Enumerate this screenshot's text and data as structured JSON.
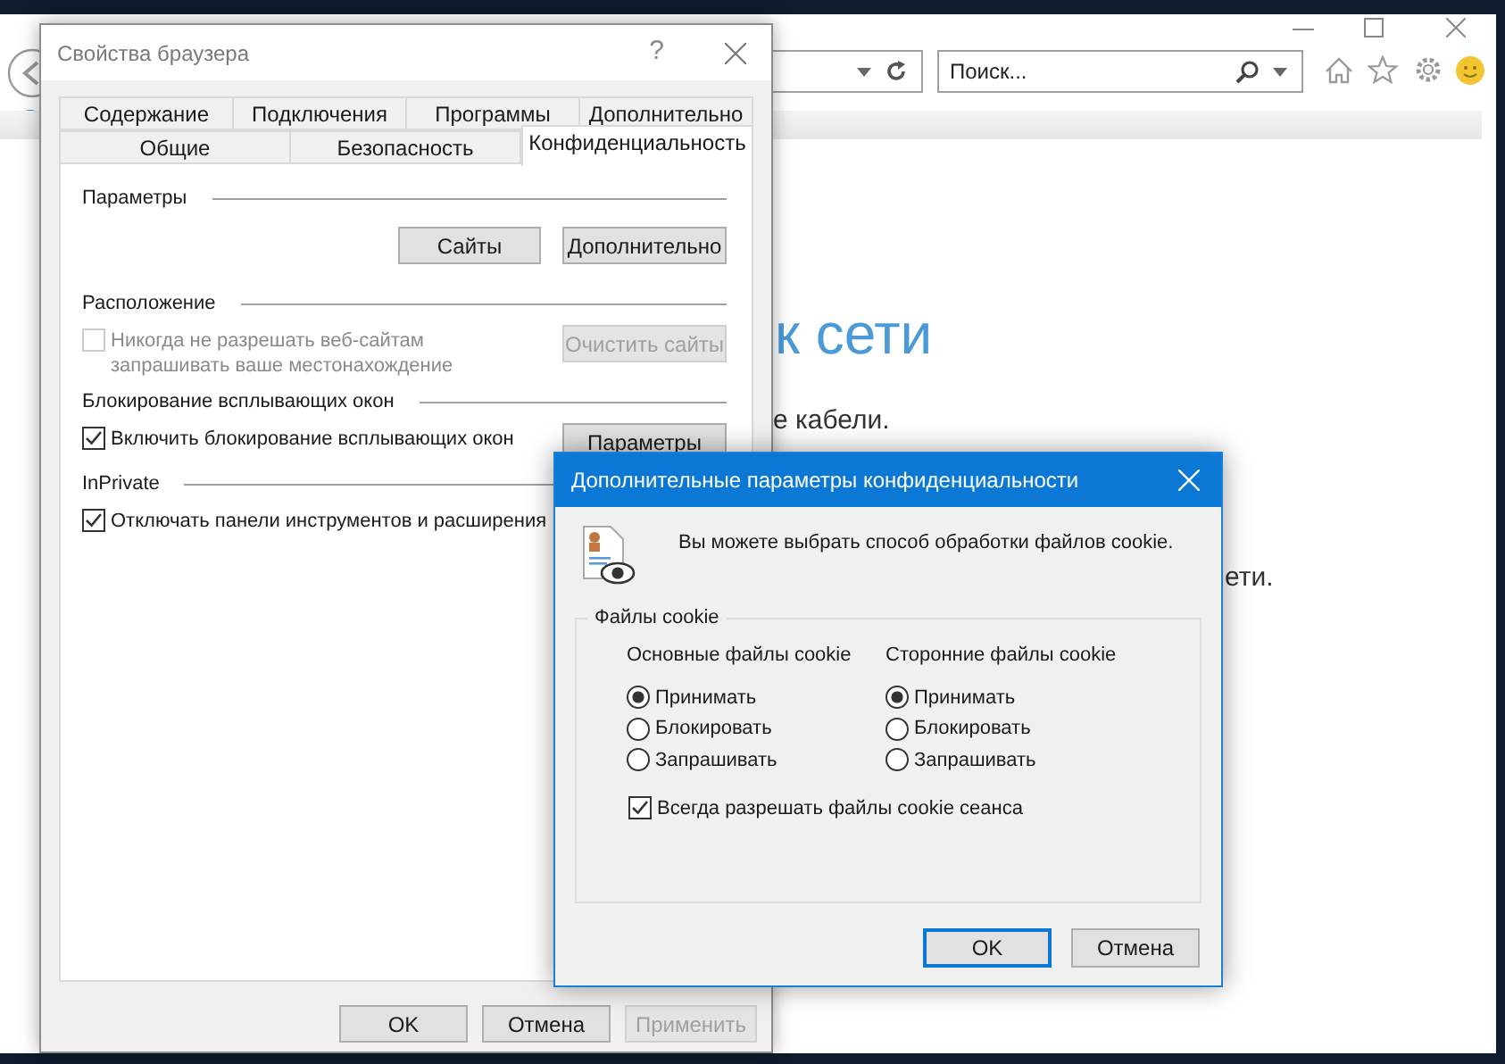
{
  "browser": {
    "search": {
      "placeholder": "Поиск..."
    },
    "content": {
      "heading": "к сети",
      "lines": [
        "е кабели.",
        "ети."
      ]
    }
  },
  "properties_dialog": {
    "title": "Свойства браузера",
    "help": "?",
    "tab_rows": [
      [
        {
          "label": "Содержание",
          "selected": false
        },
        {
          "label": "Подключения",
          "selected": false
        },
        {
          "label": "Программы",
          "selected": false
        },
        {
          "label": "Дополнительно",
          "selected": false
        }
      ],
      [
        {
          "label": "Общие",
          "selected": false
        },
        {
          "label": "Безопасность",
          "selected": false
        },
        {
          "label": "Конфиденциальность",
          "selected": true
        }
      ]
    ],
    "sections": [
      {
        "title": "Параметры",
        "rows": [
          {
            "kind": "buttons",
            "buttons": [
              {
                "label": "Сайты",
                "disabled": false
              },
              {
                "label": "Дополнительно",
                "disabled": false
              }
            ]
          }
        ]
      },
      {
        "title": "Расположение",
        "rows": [
          {
            "kind": "checkbox",
            "label": "Никогда не разрешать веб-сайтам запрашивать ваше местонахождение",
            "checked": false,
            "disabled": true,
            "button": {
              "label": "Очистить сайты",
              "disabled": true
            }
          }
        ]
      },
      {
        "title": "Блокирование всплывающих окон",
        "rows": [
          {
            "kind": "checkbox",
            "label": "Включить блокирование всплывающих окон",
            "checked": true,
            "disabled": false,
            "button": {
              "label": "Параметры",
              "disabled": false
            }
          }
        ]
      },
      {
        "title": "InPrivate",
        "rows": [
          {
            "kind": "checkbox",
            "label": "Отключать панели инструментов и расширения",
            "checked": true,
            "disabled": false
          }
        ]
      }
    ],
    "buttons": [
      {
        "label": "OK",
        "disabled": false
      },
      {
        "label": "Отмена",
        "disabled": false
      },
      {
        "label": "Применить",
        "disabled": true
      }
    ]
  },
  "advanced_dialog": {
    "title": "Дополнительные параметры конфиденциальности",
    "message": "Вы можете выбрать способ обработки файлов cookie.",
    "group": {
      "title": "Файлы cookie",
      "columns": [
        {
          "header": "Основные файлы cookie",
          "options": [
            {
              "label": "Принимать",
              "selected": true
            },
            {
              "label": "Блокировать",
              "selected": false
            },
            {
              "label": "Запрашивать",
              "selected": false
            }
          ]
        },
        {
          "header": "Сторонние файлы cookie",
          "options": [
            {
              "label": "Принимать",
              "selected": true
            },
            {
              "label": "Блокировать",
              "selected": false
            },
            {
              "label": "Запрашивать",
              "selected": false
            }
          ]
        }
      ],
      "checkbox": {
        "label": "Всегда разрешать файлы cookie сеанса",
        "checked": true
      }
    },
    "buttons": [
      {
        "label": "OK",
        "default": true
      },
      {
        "label": "Отмена",
        "default": false
      }
    ]
  }
}
